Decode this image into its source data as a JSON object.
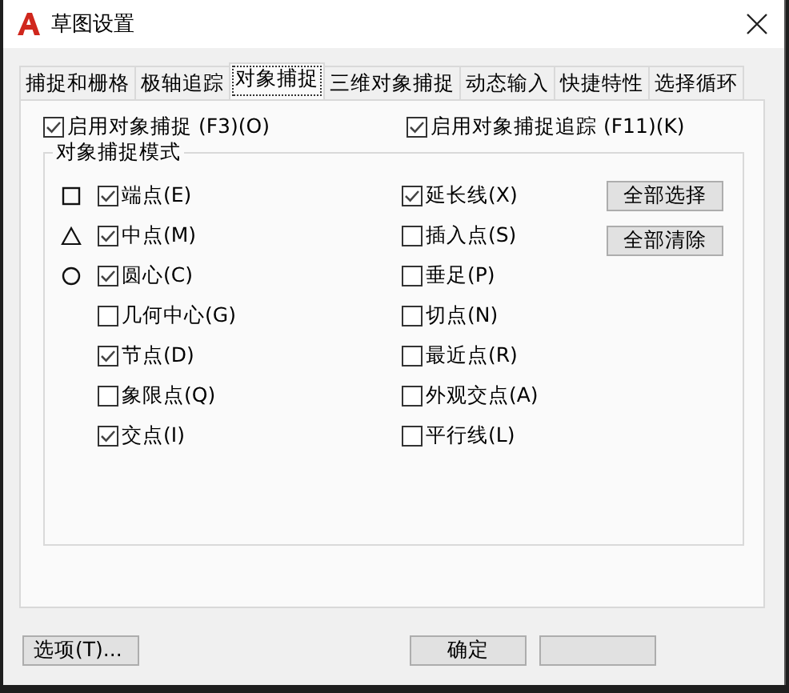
{
  "window": {
    "title": "草图设置"
  },
  "tabs": [
    {
      "label": "捕捉和栅格",
      "selected": false
    },
    {
      "label": "极轴追踪",
      "selected": false
    },
    {
      "label": "对象捕捉",
      "selected": true
    },
    {
      "label": "三维对象捕捉",
      "selected": false
    },
    {
      "label": "动态输入",
      "selected": false
    },
    {
      "label": "快捷特性",
      "selected": false
    },
    {
      "label": "选择循环",
      "selected": false
    }
  ],
  "enable_options": [
    {
      "label": "启用对象捕捉 (F3)(O)",
      "checked": true
    },
    {
      "label": "启用对象捕捉追踪 (F11)(K)",
      "checked": true
    }
  ],
  "snap_modes": {
    "title": "对象捕捉模式",
    "left": [
      {
        "kind": "square",
        "label": "端点(E)",
        "checked": true
      },
      {
        "kind": "triangle",
        "label": "中点(M)",
        "checked": true
      },
      {
        "kind": "circle",
        "label": "圆心(C)",
        "checked": true
      },
      {
        "kind": "plain",
        "label": "几何中心(G)",
        "checked": false
      },
      {
        "kind": "plain",
        "label": "节点(D)",
        "checked": true
      },
      {
        "kind": "plain",
        "label": "象限点(Q)",
        "checked": false
      },
      {
        "kind": "plain",
        "label": "交点(I)",
        "checked": true
      }
    ],
    "right": [
      {
        "label": "延长线(X)",
        "checked": true
      },
      {
        "label": "插入点(S)",
        "checked": false
      },
      {
        "label": "垂足(P)",
        "checked": false
      },
      {
        "label": "切点(N)",
        "checked": false
      },
      {
        "label": "最近点(R)",
        "checked": false
      },
      {
        "label": "外观交点(A)",
        "checked": false
      },
      {
        "label": "平行线(L)",
        "checked": false
      }
    ],
    "buttons": [
      "全部选择",
      "全部清除"
    ]
  },
  "footer": {
    "options_button": "选项(T)...",
    "ok_button": "确定"
  }
}
